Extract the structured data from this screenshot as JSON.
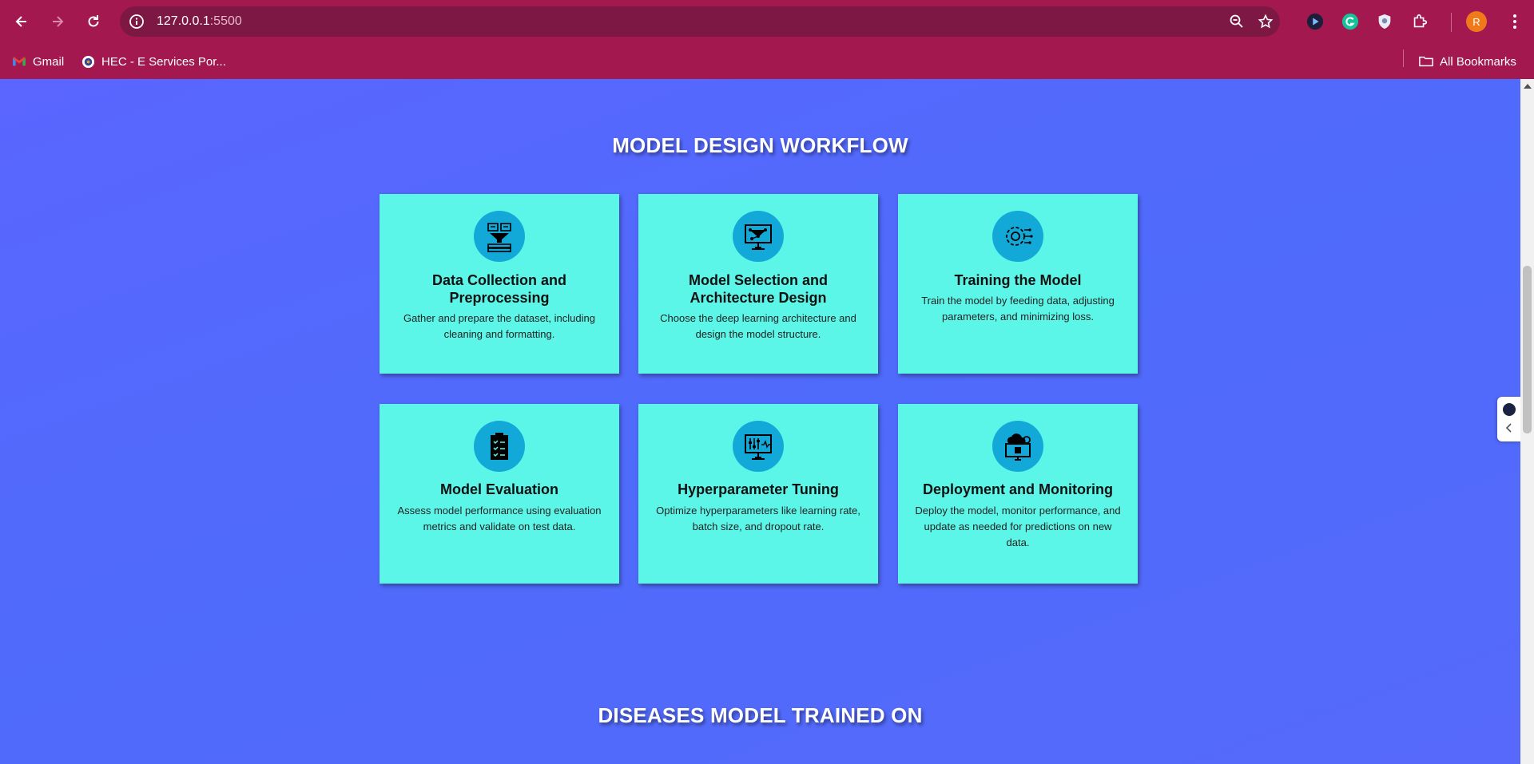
{
  "browser": {
    "url_host": "127.0.0.1",
    "url_port": ":5500",
    "profile_initial": "R",
    "bookmarks": [
      {
        "label": "Gmail",
        "icon": "gmail-icon"
      },
      {
        "label": "HEC - E Services Por...",
        "icon": "hec-icon"
      }
    ],
    "all_bookmarks_label": "All Bookmarks"
  },
  "workflow": {
    "title": "MODEL DESIGN WORKFLOW",
    "cards": [
      {
        "title": "Data Collection and Preprocessing",
        "desc": "Gather and prepare the dataset, including cleaning and formatting.",
        "icon": "data-filter-icon"
      },
      {
        "title": "Model Selection and Architecture Design",
        "desc": "Choose the deep learning architecture and design the model structure.",
        "icon": "network-monitor-icon"
      },
      {
        "title": "Training the Model",
        "desc": "Train the model by feeding data, adjusting parameters, and minimizing loss.",
        "icon": "ai-gear-icon"
      },
      {
        "title": "Model Evaluation",
        "desc": "Assess model performance using evaluation metrics and validate on test data.",
        "icon": "clipboard-checklist-icon"
      },
      {
        "title": "Hyperparameter Tuning",
        "desc": "Optimize hyperparameters like learning rate, batch size, and dropout rate.",
        "icon": "sliders-monitor-icon"
      },
      {
        "title": "Deployment and Monitoring",
        "desc": "Deploy the model, monitor performance, and update as needed for predictions on new data.",
        "icon": "cloud-monitor-icon"
      }
    ]
  },
  "diseases": {
    "title": "DISEASES MODEL TRAINED ON"
  },
  "colors": {
    "chrome": "#a3184f",
    "omnibox": "#7d1844",
    "page_bg": "#5468fb",
    "card_bg": "#5bf6e8",
    "icon_circle": "#12a9d9"
  }
}
